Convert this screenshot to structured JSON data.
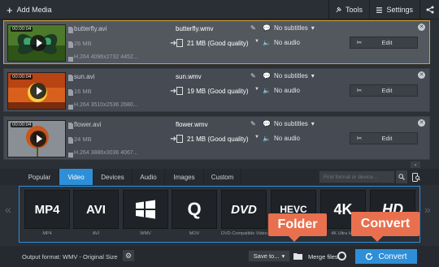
{
  "toolbar": {
    "add_media": "Add Media",
    "tools": "Tools",
    "settings": "Settings"
  },
  "files": [
    {
      "duration": "00:00:04",
      "source_name": "butterfly.avi",
      "source_size": "26 MB",
      "source_codec": "H.264 4096x2732 4452...",
      "output_name": "butterfly.wmv",
      "output_size": "21 MB (Good quality)",
      "subtitles": "No subtitles",
      "audio": "No audio",
      "edit_label": "Edit"
    },
    {
      "duration": "00:00:04",
      "source_name": "sun.avi",
      "source_size": "16 MB",
      "source_codec": "H.264 3510x2536 2680...",
      "output_name": "sun.wmv",
      "output_size": "19 MB (Good quality)",
      "subtitles": "No subtitles",
      "audio": "No audio",
      "edit_label": "Edit"
    },
    {
      "duration": "00:00:04",
      "source_name": "flower.avi",
      "source_size": "24 MB",
      "source_codec": "H.264 3886x3036 4067...",
      "output_name": "flower.wmv",
      "output_size": "21 MB (Good quality)",
      "subtitles": "No subtitles",
      "audio": "No audio",
      "edit_label": "Edit"
    }
  ],
  "tabs": [
    "Popular",
    "Video",
    "Devices",
    "Audio",
    "Images",
    "Custom"
  ],
  "active_tab": "Video",
  "search": {
    "placeholder": "Find format or device..."
  },
  "formats": [
    {
      "logo": "MP4",
      "caption": "MP4"
    },
    {
      "logo": "AVI",
      "caption": "AVI"
    },
    {
      "logo": "WMV",
      "caption": "WMV"
    },
    {
      "logo": "Q",
      "caption": "MOV"
    },
    {
      "logo": "DVD",
      "caption": "DVD-Compatible Video"
    },
    {
      "logo": "HEVC",
      "caption": ""
    },
    {
      "logo": "4K",
      "caption": "4K Ultra HD"
    },
    {
      "logo": "HD",
      "caption": ""
    }
  ],
  "callouts": {
    "folder": "Folder",
    "convert": "Convert"
  },
  "bottom": {
    "output_format": "Output format: WMV - Original Size",
    "save_to": "Save to...",
    "merge_files": "Merge files:",
    "convert": "Convert"
  },
  "colors": {
    "accent": "#2e8fd8",
    "callout": "#e9704e",
    "selected_border": "#d3a233"
  }
}
